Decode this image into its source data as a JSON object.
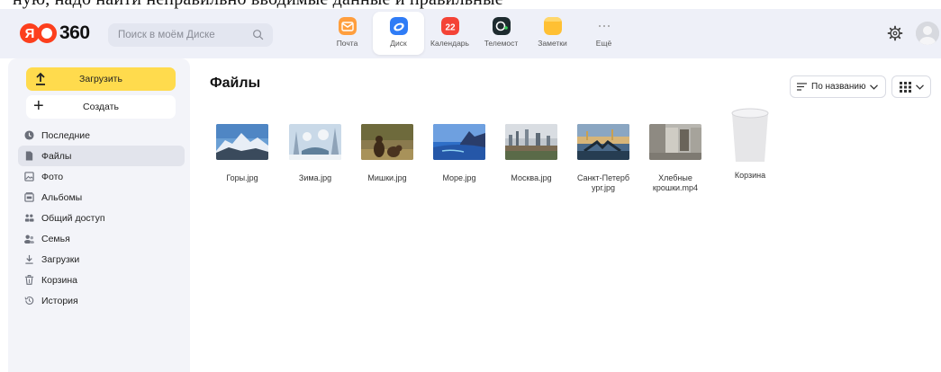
{
  "top_strip_text": "ную, надо найти неправильно вводимые данные и правильные",
  "header": {
    "logo_number": "360",
    "search_placeholder": "Поиск в моём Диске",
    "apps": [
      {
        "label": "Почта",
        "icon": "mail-icon",
        "color": "#ff9e3d",
        "active": false
      },
      {
        "label": "Диск",
        "icon": "disk-icon",
        "color": "#2f7cf6",
        "active": true
      },
      {
        "label": "Календарь",
        "icon": "calendar-icon",
        "color": "#f44336",
        "badge": "22",
        "active": false
      },
      {
        "label": "Телемост",
        "icon": "telemost-icon",
        "color": "#1e2b2f",
        "active": false
      },
      {
        "label": "Заметки",
        "icon": "notes-icon",
        "color": "#ffc033",
        "active": false
      },
      {
        "label": "Ещё",
        "icon": "more-icon",
        "color": "#999999",
        "active": false
      }
    ]
  },
  "sidebar": {
    "upload_label": "Загрузить",
    "create_label": "Создать",
    "items": [
      {
        "label": "Последние",
        "icon": "clock-icon",
        "active": false
      },
      {
        "label": "Файлы",
        "icon": "file-icon",
        "active": true
      },
      {
        "label": "Фото",
        "icon": "photo-icon",
        "active": false
      },
      {
        "label": "Альбомы",
        "icon": "album-icon",
        "active": false
      },
      {
        "label": "Общий доступ",
        "icon": "shared-icon",
        "active": false
      },
      {
        "label": "Семья",
        "icon": "family-icon",
        "active": false
      },
      {
        "label": "Загрузки",
        "icon": "download-icon",
        "active": false
      },
      {
        "label": "Корзина",
        "icon": "trash-icon",
        "active": false
      },
      {
        "label": "История",
        "icon": "history-icon",
        "active": false
      }
    ]
  },
  "main": {
    "title": "Файлы",
    "sort_label": "По названию",
    "files": [
      {
        "name": "Горы.jpg",
        "thumb": "mountains"
      },
      {
        "name": "Зима.jpg",
        "thumb": "winter"
      },
      {
        "name": "Мишки.jpg",
        "thumb": "bears"
      },
      {
        "name": "Море.jpg",
        "thumb": "sea"
      },
      {
        "name": "Москва.jpg",
        "thumb": "moscow"
      },
      {
        "name": "Санкт-Петербург.jpg",
        "name_line1": "Санкт-Петерб",
        "name_line2": "ург.jpg",
        "thumb": "spb"
      },
      {
        "name": "Хлебные крошки.mp4",
        "name_line1": "Хлебные",
        "name_line2": "крошки.mp4",
        "thumb": "crumbs"
      },
      {
        "name": "Корзина",
        "thumb": "trash"
      }
    ]
  },
  "colors": {
    "header_bg": "#eef0f8",
    "sidebar_bg": "#f3f4f9",
    "upload_bg": "#ffdb4d",
    "logo_red": "#fc3f1d"
  }
}
